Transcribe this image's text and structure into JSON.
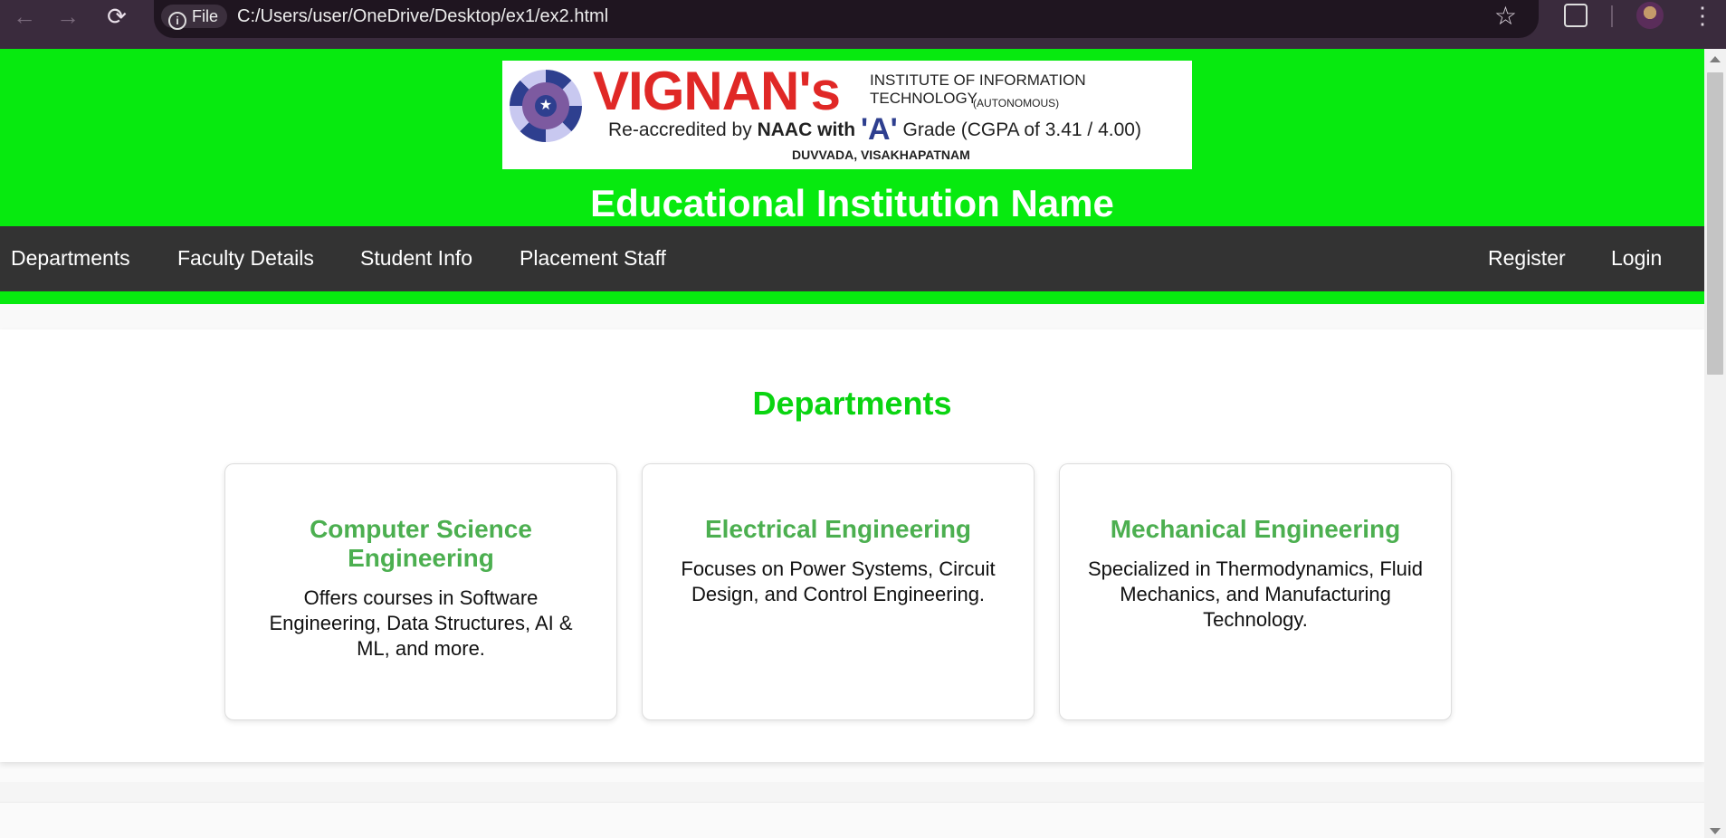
{
  "browser": {
    "url": "C:/Users/user/OneDrive/Desktop/ex1/ex2.html",
    "scheme_label": "File"
  },
  "logo": {
    "brand": "VIGNAN's",
    "institute": "INSTITUTE OF INFORMATION TECHNOLOGY",
    "autonomous": "(AUTONOMOUS)",
    "accreditation_prefix": "Re-accredited by",
    "accreditation_body": "NAAC",
    "accreditation_with": "with",
    "grade": "'A'",
    "grade_suffix": "Grade (CGPA of 3.41 / 4.00)",
    "location": "DUVVADA, VISAKHAPATNAM"
  },
  "header": {
    "title": "Educational Institution Name"
  },
  "nav": {
    "departments": "Departments",
    "faculty": "Faculty Details",
    "student": "Student Info",
    "placement": "Placement Staff",
    "register": "Register",
    "login": "Login"
  },
  "departments": {
    "heading": "Departments",
    "cards": [
      {
        "title": "Computer Science Engineering",
        "description": "Offers courses in Software Engineering, Data Structures, AI & ML, and more."
      },
      {
        "title": "Electrical Engineering",
        "description": "Focuses on Power Systems, Circuit Design, and Control Engineering."
      },
      {
        "title": "Mechanical Engineering",
        "description": "Specialized in Thermodynamics, Fluid Mechanics, and Manufacturing Technology."
      }
    ]
  },
  "colors": {
    "header_green": "#07ea0f",
    "nav_dark": "#333333",
    "heading_green": "#0ad411",
    "card_title_green": "#4caf50"
  }
}
